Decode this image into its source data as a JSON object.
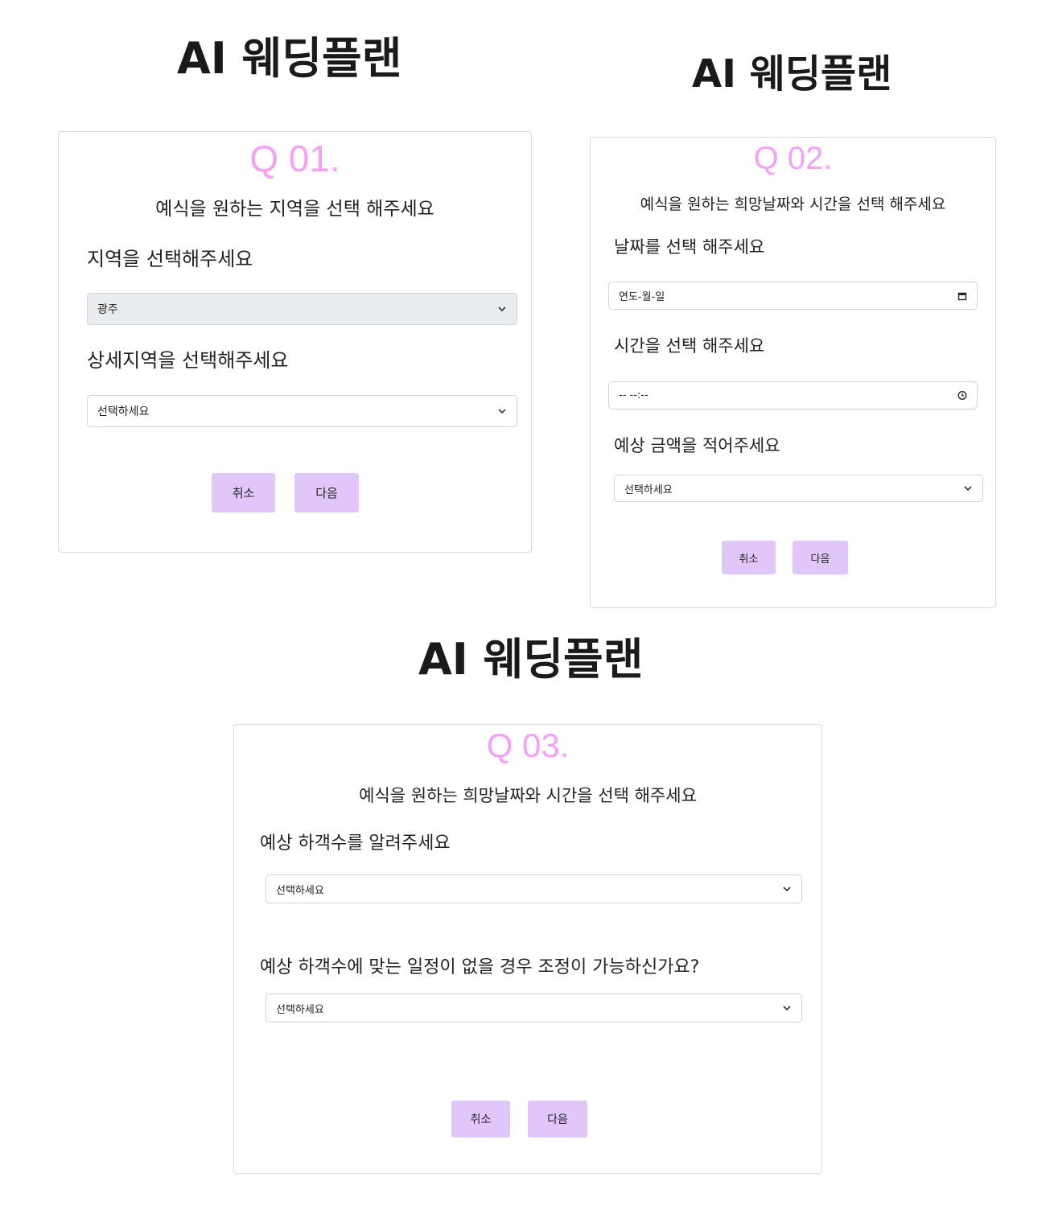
{
  "panels": [
    {
      "app_title": "AI 웨딩플랜",
      "question_number": "Q 01.",
      "subtitle": "예식을 원하는 지역을 선택 해주세요",
      "fields": [
        {
          "label": "지역을 선택해주세요",
          "value": "광주"
        },
        {
          "label": "상세지역을 선택해주세요",
          "value": "선택하세요"
        }
      ],
      "cancel_label": "취소",
      "next_label": "다음"
    },
    {
      "app_title": "AI 웨딩플랜",
      "question_number": "Q 02.",
      "subtitle": "예식을 원하는 희망날짜와 시간을 선택 해주세요",
      "fields": [
        {
          "label": "날짜를 선택 해주세요",
          "value": "연도-월-일"
        },
        {
          "label": "시간을 선택 해주세요",
          "value": "-- --:--"
        },
        {
          "label": "예상 금액을 적어주세요",
          "value": "선택하세요"
        }
      ],
      "cancel_label": "취소",
      "next_label": "다음"
    },
    {
      "app_title": "AI 웨딩플랜",
      "question_number": "Q 03.",
      "subtitle": "예식을 원하는 희망날짜와 시간을 선택 해주세요",
      "fields": [
        {
          "label": "예상 하객수를 알려주세요",
          "value": "선택하세요"
        },
        {
          "label": "예상 하객수에 맞는 일정이 없을 경우 조정이 가능하신가요?",
          "value": "선택하세요"
        }
      ],
      "cancel_label": "취소",
      "next_label": "다음"
    }
  ],
  "icons": {
    "dropdown": "chevron-down-icon",
    "date": "calendar-icon",
    "time": "clock-icon"
  },
  "colors": {
    "question_number": "#f4a0f4",
    "button_bg": "#e1c7f9",
    "selected_field_bg": "#e9ecef",
    "card_border": "#d9d9d9"
  }
}
